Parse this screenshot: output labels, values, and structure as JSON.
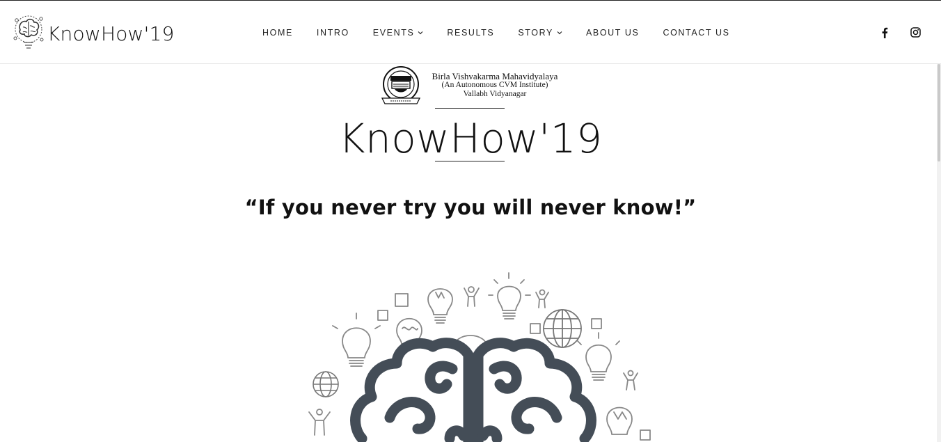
{
  "header": {
    "brand_name": "KnowHow'19",
    "brand_logo_icon": "brain-gears-icon"
  },
  "nav": {
    "items": [
      {
        "label": "HOME",
        "has_dropdown": false
      },
      {
        "label": "INTRO",
        "has_dropdown": false
      },
      {
        "label": "EVENTS",
        "has_dropdown": true
      },
      {
        "label": "RESULTS",
        "has_dropdown": false
      },
      {
        "label": "STORY",
        "has_dropdown": true
      },
      {
        "label": "ABOUT US",
        "has_dropdown": false
      },
      {
        "label": "CONTACT US",
        "has_dropdown": false
      }
    ]
  },
  "social": {
    "items": [
      {
        "icon": "facebook-icon"
      },
      {
        "icon": "instagram-icon"
      }
    ]
  },
  "college": {
    "line1": "Birla Vishvakarma Mahavidyalaya",
    "line2": "(An Autonomous CVM Institute)",
    "line3": "Vallabh Vidyanagar",
    "seal_icon": "college-seal-icon"
  },
  "hero": {
    "title": "KnowHow'19",
    "tagline": "“If you never try you will never know!”"
  },
  "illustration": {
    "icon": "brain-ideas-illustration",
    "brain_color": "#444d57",
    "line_color": "#888888"
  }
}
